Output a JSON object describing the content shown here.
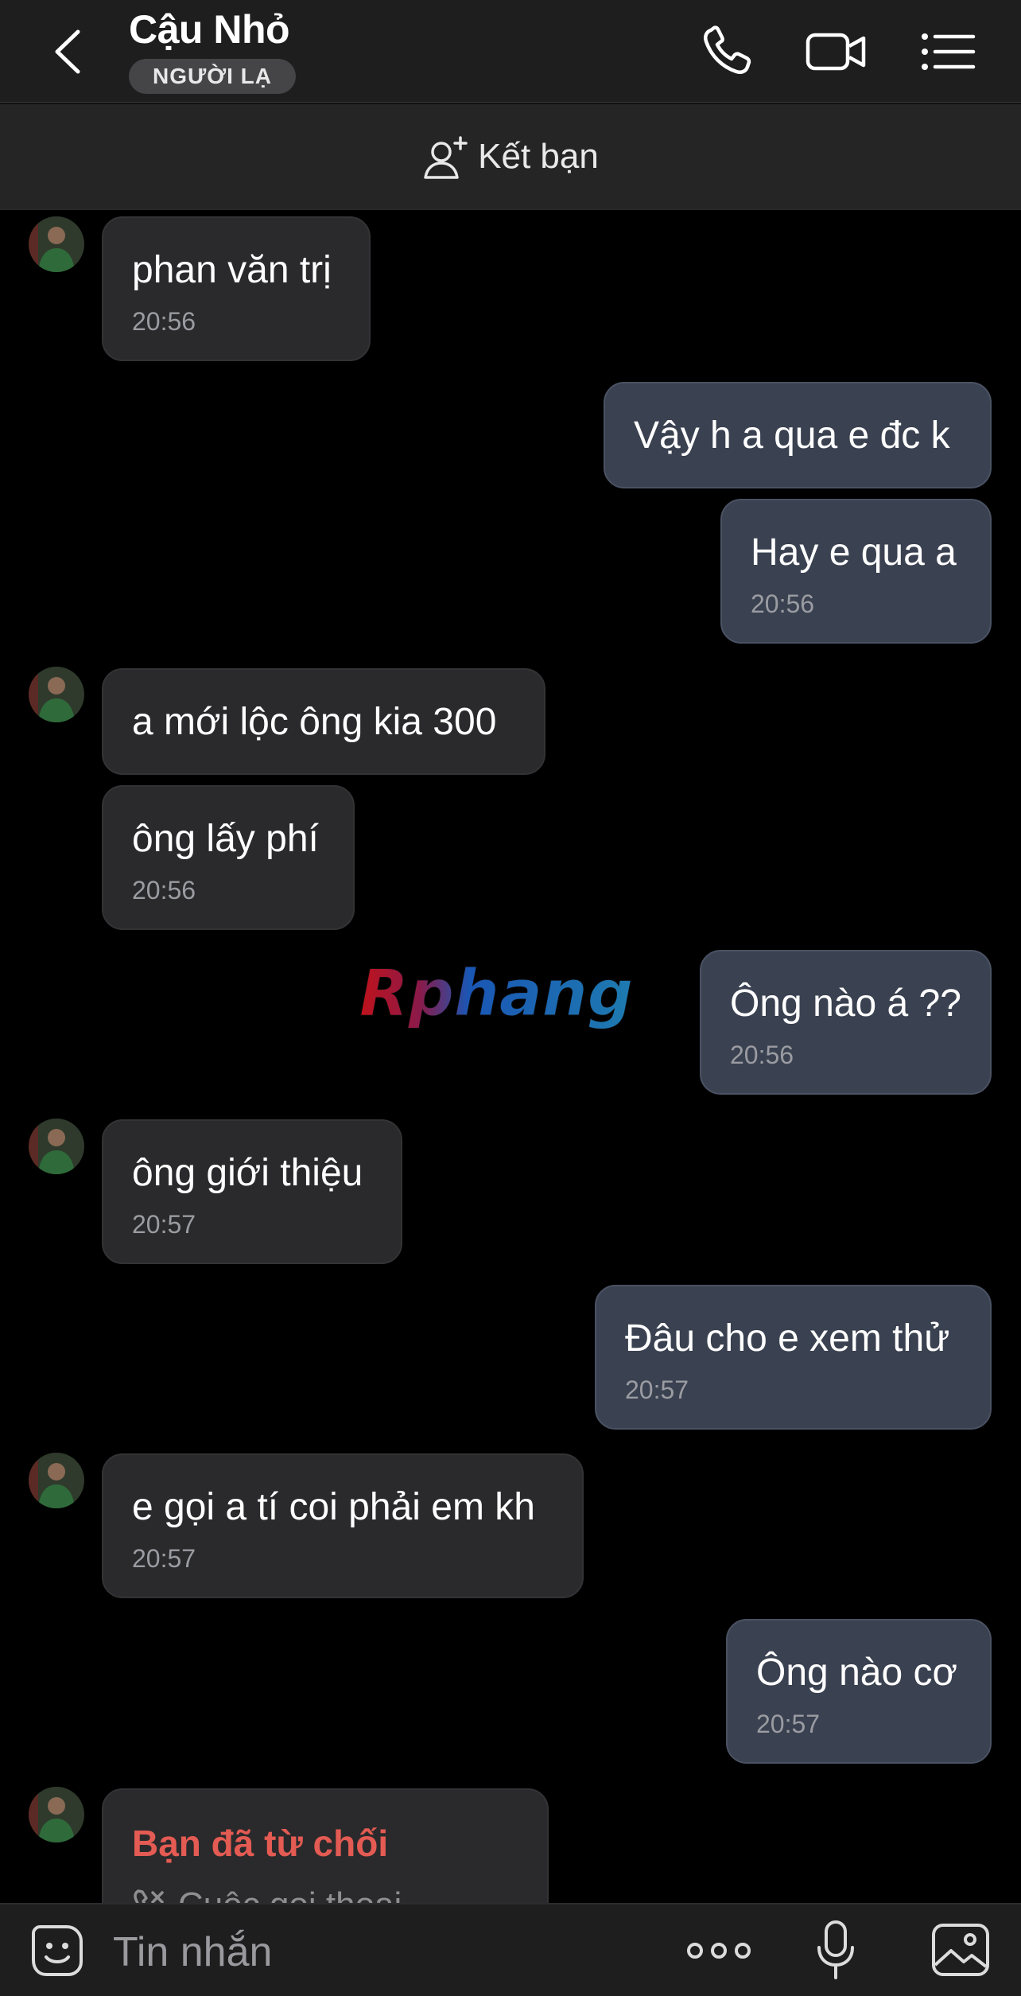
{
  "header": {
    "contact_name": "Cậu Nhỏ",
    "badge": "NGƯỜI LẠ",
    "icons": [
      "back-arrow-icon",
      "phone-icon",
      "video-icon",
      "list-menu-icon"
    ]
  },
  "friend_bar": {
    "label": "Kết bạn",
    "icon": "add-friend-icon"
  },
  "messages": [
    {
      "from": "them",
      "text": "phan văn trị",
      "time": "20:56"
    },
    {
      "from": "me",
      "text": "Vậy h a qua e đc k"
    },
    {
      "from": "me",
      "text": "Hay e qua a",
      "time": "20:56"
    },
    {
      "from": "them",
      "text": "a mới lộc ông kia 300"
    },
    {
      "from": "them",
      "text": "ông lấy phí",
      "time": "20:56"
    },
    {
      "from": "me",
      "text": "Ông nào á ??",
      "time": "20:56"
    },
    {
      "from": "them",
      "text": "ông giới thiệu",
      "time": "20:57"
    },
    {
      "from": "me",
      "text": "Đâu cho e xem thử",
      "time": "20:57"
    },
    {
      "from": "them",
      "text": "e gọi a tí coi phải em kh",
      "time": "20:57"
    },
    {
      "from": "me",
      "text": "Ông nào cơ",
      "time": "20:57"
    },
    {
      "from": "them",
      "declined": "Bạn đã từ chối",
      "call_label": "Cuộc gọi thoại"
    }
  ],
  "watermark": "Rphang",
  "composer": {
    "placeholder": "Tin nhắn",
    "icons": [
      "sticker-icon",
      "more-dots-icon",
      "microphone-icon",
      "image-icon"
    ]
  },
  "colors": {
    "background": "#000000",
    "header": "#1e1e1f",
    "incoming_bubble": "#2a2a2c",
    "outgoing_bubble": "#3a4150",
    "declined_red": "#e35b53"
  }
}
